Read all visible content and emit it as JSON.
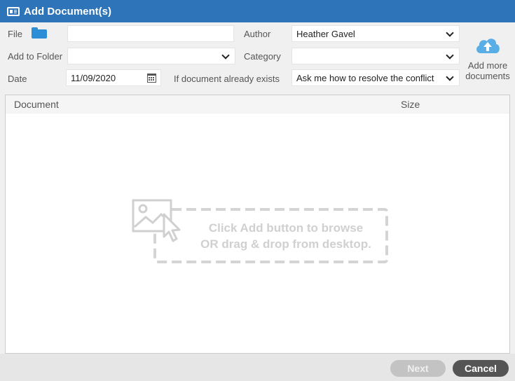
{
  "window": {
    "title": "Add Document(s)"
  },
  "form": {
    "file_label": "File",
    "file_value": "",
    "add_to_folder_label": "Add to Folder",
    "add_to_folder_value": "",
    "date_label": "Date",
    "date_value": "11/09/2020",
    "author_label": "Author",
    "author_value": "Heather Gavel",
    "category_label": "Category",
    "category_value": "",
    "exists_label": "If document already exists",
    "exists_value": "Ask me how to resolve the conflict"
  },
  "add_more": {
    "line1": "Add more",
    "line2": "documents"
  },
  "table": {
    "columns": [
      "Document",
      "Size"
    ],
    "rows": []
  },
  "drop_hint": {
    "line1": "Click Add button to browse",
    "line2": "OR drag & drop from desktop."
  },
  "footer": {
    "next_label": "Next",
    "cancel_label": "Cancel"
  },
  "colors": {
    "titlebar": "#2d74b8",
    "accent": "#2d8ed8",
    "cancel": "#555555",
    "next_disabled": "#c3c3c3"
  },
  "icons": {
    "title": "document-window-icon",
    "file": "folder-icon",
    "date": "calendar-icon",
    "add_more": "cloud-upload-icon",
    "drop": "image-cursor-icon",
    "dropdown": "chevron-down-icon"
  }
}
